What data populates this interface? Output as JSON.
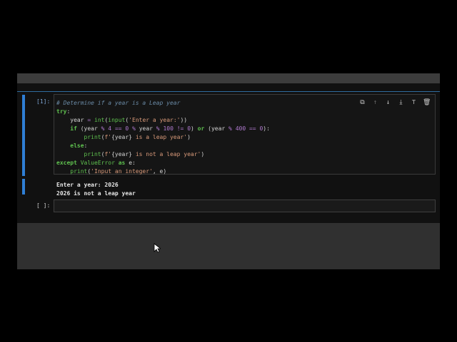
{
  "cell1": {
    "prompt": "[1]:",
    "code_lines": [
      "# Determine if a year is a Leap year",
      "try:",
      "    year = int(input('Enter a year:'))",
      "    if (year % 4 == 0 % year % 100 != 0) or (year % 400 == 0):",
      "        print(f'{year} is a leap year')",
      "    else:",
      "        print(f'{year} is not a leap year')",
      "except ValueError as e:",
      "    print('Input an integer', e)"
    ],
    "output_lines": [
      "Enter a year: 2026",
      "2026 is not a leap year"
    ]
  },
  "cell2": {
    "prompt": "[ ]:",
    "input": ""
  },
  "toolbar": {
    "icons": [
      "copy-icon",
      "move-up-icon",
      "move-down-icon",
      "insert-below-icon",
      "format-icon",
      "delete-icon"
    ]
  },
  "colors": {
    "accent": "#2f7fd6",
    "background": "#111111",
    "panel": "#303030"
  }
}
